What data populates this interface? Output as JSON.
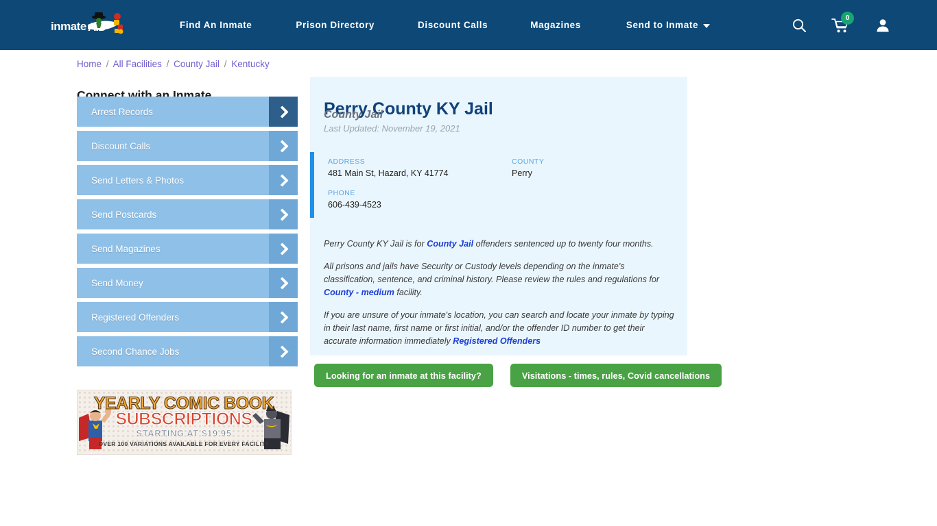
{
  "header": {
    "logo_text": "inmateAID",
    "logo_icon": "inmateaid-logo-icon",
    "nav": [
      {
        "label": "Find An Inmate"
      },
      {
        "label": "Prison Directory"
      },
      {
        "label": "Discount Calls"
      },
      {
        "label": "Magazines"
      },
      {
        "label": "Send to Inmate",
        "has_dropdown": true
      }
    ],
    "icons": {
      "search": "search-icon",
      "cart": "shopping-cart-icon",
      "cart_badge": "0",
      "account": "user-account-icon"
    },
    "colors": {
      "background": "#0d4876",
      "badge": "#17a673"
    }
  },
  "breadcrumb": {
    "items": [
      {
        "label": "Home"
      },
      {
        "label": "All Facilities"
      },
      {
        "label": "County Jail"
      },
      {
        "label": "Kentucky"
      }
    ],
    "separator": "/"
  },
  "sidebar": {
    "title": "Connect with an Inmate",
    "items": [
      {
        "label": "Arrest Records",
        "active": true
      },
      {
        "label": "Discount Calls",
        "active": false
      },
      {
        "label": "Send Letters & Photos",
        "active": false
      },
      {
        "label": "Send Postcards",
        "active": false
      },
      {
        "label": "Send Magazines",
        "active": false
      },
      {
        "label": "Send Money",
        "active": false
      },
      {
        "label": "Registered Offenders",
        "active": false
      },
      {
        "label": "Second Chance Jobs",
        "active": false
      }
    ],
    "arrow_icon": "chevron-right-icon"
  },
  "ad": {
    "line1": "YEARLY COMIC BOOK",
    "line2": "SUBSCRIPTIONS",
    "line3": "STARTING AT $19.95",
    "line4": "OVER 100 VARIATIONS AVAILABLE FOR EVERY FACILITY",
    "left_character": "superman-icon",
    "right_character": "batman-icon"
  },
  "facility": {
    "title": "Perry County KY Jail",
    "subtitle": "County Jail",
    "last_updated": "Last Updated: November 19, 2021",
    "info": {
      "address_label": "ADDRESS",
      "address_value": "481 Main St, Hazard, KY 41774",
      "county_label": "COUNTY",
      "county_value": "Perry",
      "phone_label": "PHONE",
      "phone_value": "606-439-4523"
    },
    "description": {
      "p1_a": "Perry County KY Jail is for ",
      "p1_link": "County Jail",
      "p1_b": " offenders sentenced up to twenty four months.",
      "p2_a": "All prisons and jails have Security or Custody levels depending on the inmate's classification, sentence, and criminal history. Please review the rules and regulations for ",
      "p2_link": "County - medium",
      "p2_b": " facility.",
      "p3_a": "If you are unsure of your inmate's location, you can search and locate your inmate by typing in their last name, first name or first initial, and/or the offender ID number to get their accurate information immediately ",
      "p3_link": "Registered Offenders"
    },
    "colors": {
      "card_background": "#eaf6fd",
      "accent_bar": "#1e90e8",
      "title": "#10427a"
    }
  },
  "cta": {
    "primary_label": "Looking for an inmate at this facility?",
    "secondary_label": "Visitations - times, rules, Covid cancellations",
    "color": "#49a244"
  }
}
